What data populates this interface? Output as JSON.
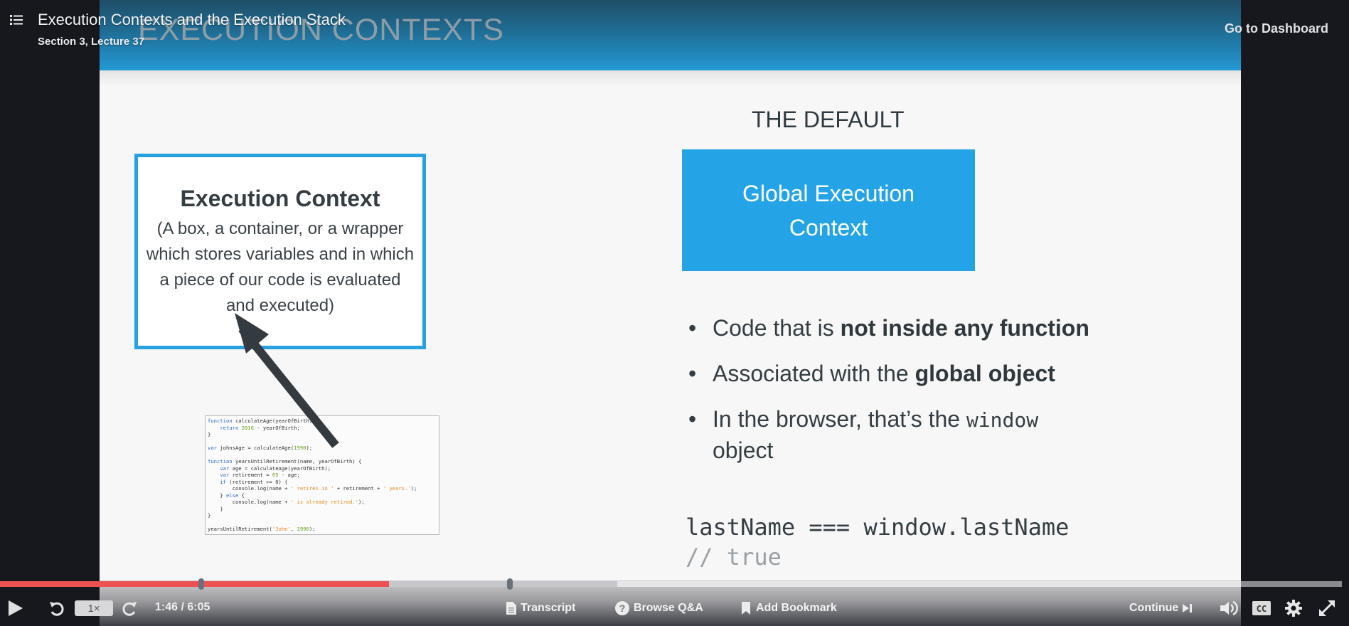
{
  "header": {
    "title": "Execution Contexts and the Execution Stack",
    "subtitle": "Section 3, Lecture 37",
    "dashboard_link": "Go to Dashboard"
  },
  "slide": {
    "heading": "EXECUTION CONTEXTS",
    "execution_context_box": {
      "title": "Execution Context",
      "description": "(A box, a container, or a wrapper which stores variables and in which a piece of our code is evaluated and executed)"
    },
    "code_snippet": {
      "lines": [
        "function calculateAge(yearOfBirth) {",
        "    return 2016 - yearOfBirth;",
        "}",
        "",
        "var johnsAge = calculateAge(1990);",
        "",
        "function yearsUntilRetirement(name, yearOfBirth) {",
        "    var age = calculateAge(yearOfBirth);",
        "    var retirement = 65 - age;",
        "    if (retirement >= 0) {",
        "        console.log(name + ' retires in ' + retirement + ' years.');",
        "    } else {",
        "        console.log(name + ' is already retired.');",
        "    }",
        "}",
        "",
        "yearsUntilRetirement('John', 1990);"
      ]
    },
    "default_title": "THE DEFAULT",
    "global_box_label": "Global Execution Context",
    "bullets": [
      {
        "prefix": "Code that is ",
        "bold": "not inside any function",
        "mono": "",
        "suffix": ""
      },
      {
        "prefix": "Associated with the ",
        "bold": "global object",
        "mono": "",
        "suffix": ""
      },
      {
        "prefix": "In the browser, that’s the ",
        "bold": "",
        "mono": "window",
        "suffix": " object"
      }
    ],
    "code_line": "lastName === window.lastName",
    "code_comment": "// true",
    "colors": {
      "accent_blue": "#24a4e6",
      "box_border": "#27a1e0",
      "header_gradient_top": "#1f4e66",
      "header_gradient_bottom": "#2399d4"
    }
  },
  "player": {
    "current_time": "1:46",
    "duration": "6:05",
    "time_display": "1:46 / 6:05",
    "played_fraction": 0.29,
    "buffered_fraction": 0.46,
    "marker_fractions": [
      0.15,
      0.38
    ],
    "speed": "1×",
    "buttons": {
      "play": "play-icon",
      "rewind": "rewind-icon",
      "forward": "forward-icon",
      "transcript": "Transcript",
      "qa": "Browse Q&A",
      "bookmark": "Add Bookmark",
      "continue": "Continue",
      "volume": "volume-icon",
      "captions": "CC",
      "settings": "gear-icon",
      "fullscreen": "fullscreen-icon"
    },
    "colors": {
      "played": "#ec5252",
      "buffered": "#c5c7ca",
      "marker": "#6b707a"
    }
  }
}
